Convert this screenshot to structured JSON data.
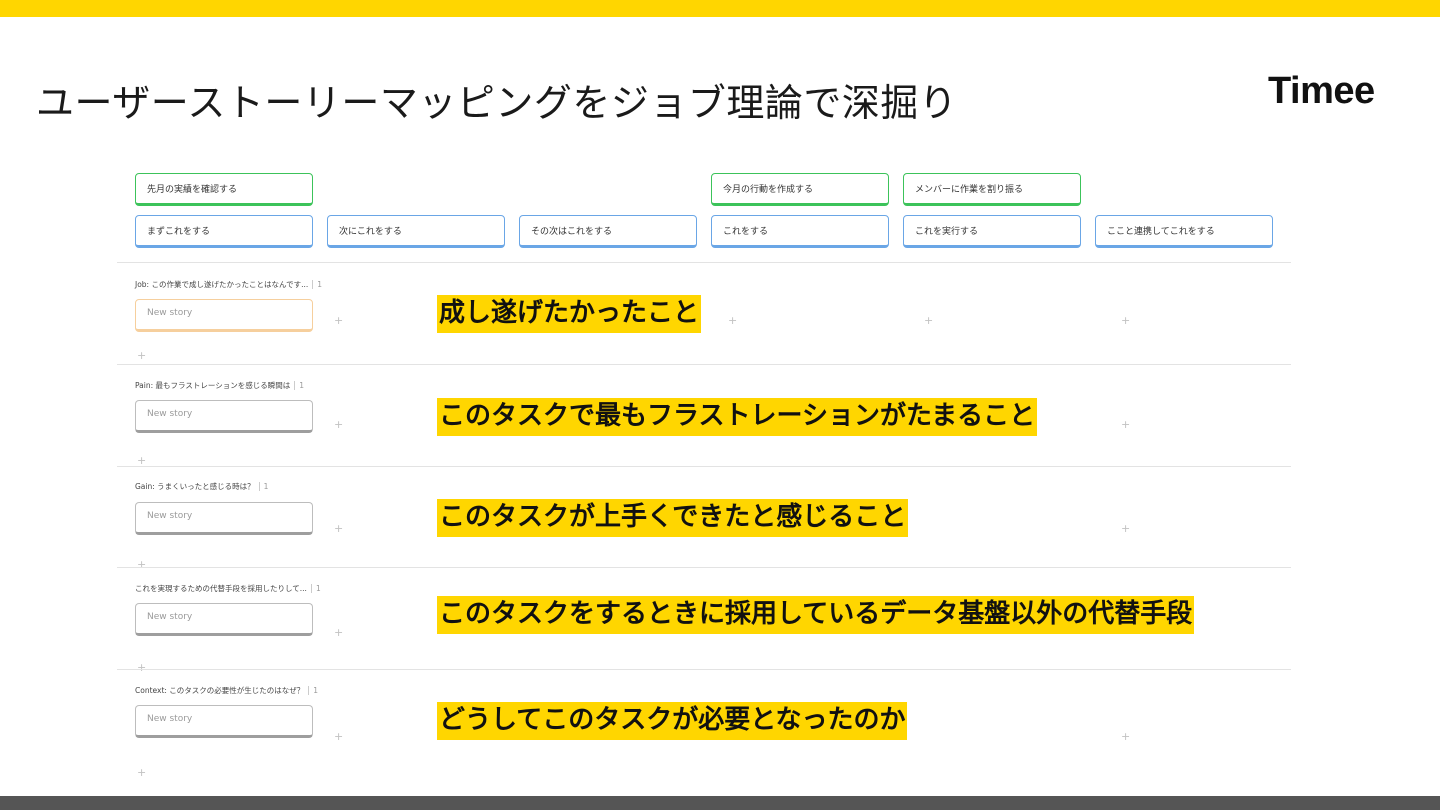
{
  "slide": {
    "title": "ユーザーストーリーマッピングをジョブ理論で深掘り",
    "brand": "Timee",
    "brand_color": "#FFD600"
  },
  "story_map": {
    "activities": [
      "先月の実績を確認する",
      "今月の行動を作成する",
      "メンバーに作業を割り振る"
    ],
    "steps": [
      "まずこれをする",
      "次にこれをする",
      "その次はこれをする",
      "これをする",
      "これを実行する",
      "ここと連携してこれをする"
    ],
    "rows": [
      {
        "label": "Job: この作業で成し遂げたかったことはなんです...",
        "count": "1",
        "story_placeholder": "New story",
        "annotation": "成し遂げたかったこと"
      },
      {
        "label": "Pain: 最もフラストレーションを感じる瞬間は",
        "count": "1",
        "story_placeholder": "New story",
        "annotation": "このタスクで最もフラストレーションがたまること"
      },
      {
        "label": "Gain: うまくいったと感じる時は？",
        "count": "1",
        "story_placeholder": "New story",
        "annotation": "このタスクが上手くできたと感じること"
      },
      {
        "label": "これを実現するための代替手段を採用したりして...",
        "count": "1",
        "story_placeholder": "New story",
        "annotation": "このタスクをするときに採用しているデータ基盤以外の代替手段"
      },
      {
        "label": "Context: このタスクの必要性が生じたのはなぜ？",
        "count": "1",
        "story_placeholder": "New story",
        "annotation": "どうしてこのタスクが必要となったのか"
      }
    ],
    "add_glyph": "+"
  }
}
